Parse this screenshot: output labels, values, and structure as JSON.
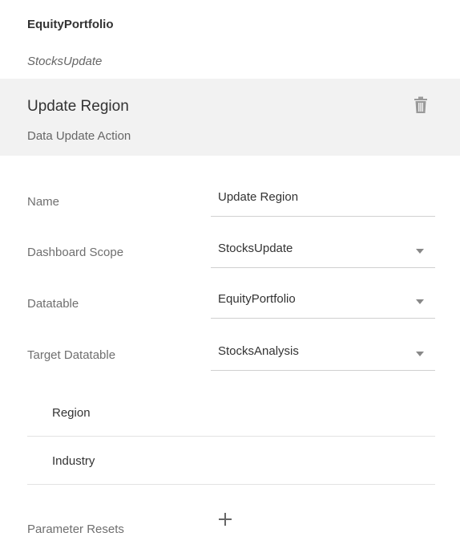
{
  "header": {
    "datasource": "EquityPortfolio",
    "dashboard": "StocksUpdate"
  },
  "action": {
    "title": "Update Region",
    "type": "Data Update Action",
    "delete_icon": "trash-icon"
  },
  "form": {
    "name": {
      "label": "Name",
      "value": "Update Region"
    },
    "dashboard_scope": {
      "label": "Dashboard Scope",
      "value": "StocksUpdate",
      "icon": "chevron-down-icon"
    },
    "datatable": {
      "label": "Datatable",
      "value": "EquityPortfolio",
      "icon": "chevron-down-icon"
    },
    "target_datatable": {
      "label": "Target Datatable",
      "value": "StocksAnalysis",
      "icon": "chevron-down-icon"
    }
  },
  "mappings": [
    "Region",
    "Industry"
  ],
  "parameter_resets": {
    "label": "Parameter Resets",
    "add_icon": "plus-icon"
  },
  "colors": {
    "panel_background": "#f2f2f2",
    "text_primary": "#333333",
    "text_secondary": "#6f6f6f",
    "divider": "#d0d0d0"
  }
}
